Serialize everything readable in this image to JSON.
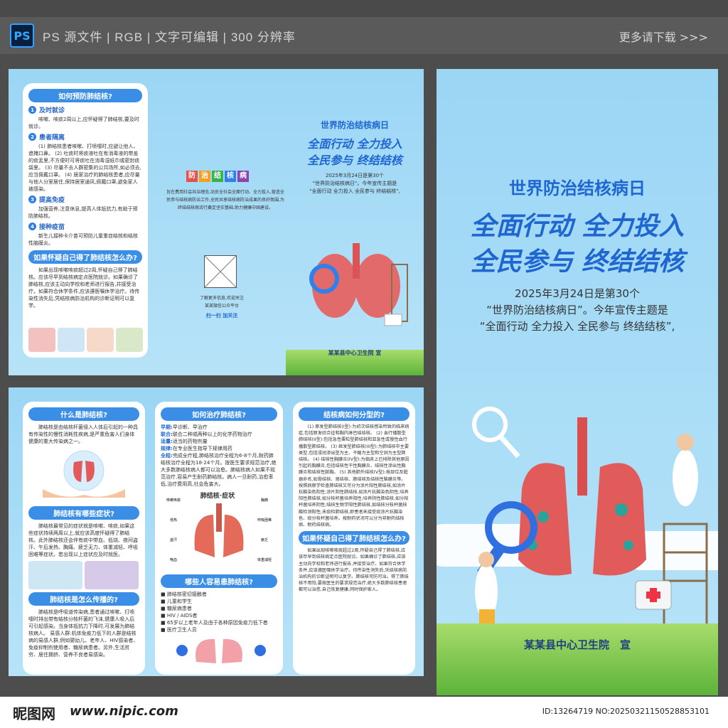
{
  "toolbar": {
    "app_icon": "PS",
    "info": "PS 源文件 | RGB | 文字可编辑 | 300 分辨率",
    "more": "更多请下载 >>>"
  },
  "left_top": {
    "prevent": {
      "title": "如何预防肺结核?",
      "items": [
        {
          "n": "1",
          "h": "及时就诊",
          "t": "咳嗽、咳痰2周以上,应怀疑得了肺结核,要及时就诊。"
        },
        {
          "n": "2",
          "h": "患者隔离",
          "t": "(1) 肺结核患者咳嗽、打喷嚏时,应避让他人、遮掩口鼻。 (2) 吐痰时将痰液吐在有消毒液的带盖的痰盂里,不方便时可将痰吐在消毒湿纸巾或密封痰袋里。 (3) 尽量不去人群密集的公共场所,如必须去,应当佩戴口罩。 (4) 居家治疗的肺结核患者,应尽量与他人分室居住,保持居室通风,佩戴口罩,避免家人被感染。"
        },
        {
          "n": "3",
          "h": "提高免疫",
          "t": "加强营养,注意休息,提高人体抵抗力,有助于预防肺结核。"
        },
        {
          "n": "4",
          "h": "接种疫苗",
          "t": "新生儿接种卡介苗可预防儿童重症结核和结核性脑膜炎。"
        }
      ],
      "suspect_title": "如果怀疑自己得了肺结核怎么办?",
      "suspect_text": "如果出现咳嗽咳痰超过2周,怀疑自己得了肺结核。应该尽早到结核病定点医院就诊。如果确诊了肺结核,应该主动向学校和老师进行报告,并接受治疗。如果符合休学条件,应该遵医嘱休学治疗。待传染性消失后,凭结核病防治机构的诊断证明可以复学。"
    },
    "middle": {
      "badges": [
        "防",
        "治",
        "结",
        "核",
        "病"
      ],
      "intro": "旨在费用社会共治理念,动员全社会全面行动、全力投入,营造全民参与结核病防治工作,全民共享结核病防治成果的良好氛围,为终结结核病流行奠定坚实基础,助力健康中国建设。",
      "qr_text1": "了解更多信息,欢迎关注",
      "qr_text2": "某某微信公众平台",
      "qr_text3": "扫一扫 加关注"
    },
    "cover_small": {
      "t1": "世界防治结核病日",
      "t2": "全面行动 全力投入",
      "t3": "全民参与 终结结核",
      "s1": "2025年3月24日是第30个",
      "s2": "\"世界防治结核病日\"。今年宣传主题是",
      "s3": "\"全面行动 全力投入 全民参与 终结结核\",",
      "org": "某某县中心卫生院 宣"
    }
  },
  "cover": {
    "t1": "世界防治结核病日",
    "t2": "全面行动 全力投入",
    "t3": "全民参与 终结结核",
    "s1": "2025年3月24日是第30个",
    "s2": "“世界防治结核病日”。今年宣传主题是",
    "s3": "“全面行动 全力投入 全民参与 终结结核”,",
    "org": "某某县中心卫生院　宣"
  },
  "bottom": {
    "what": {
      "title": "什么是肺结核?",
      "text": "肺结核是由结核杆菌侵入人体后引起的一种具有传染性的慢性消耗性疾病,是严重危害人们身体健康的重大传染病之一。"
    },
    "symptom": {
      "title": "肺结核有哪些症状?",
      "text": "肺结核最常见的症状就是咳嗽、咳痰,如果这些症状持续两周以上,就应该高度怀疑得了肺结核。此外肺结核还会伴有痰中带血、低烧、夜间盗汗、午后发热、胸痛、疲乏无力、体重减轻、呼吸困难等症状。若出现以上症状应及时就医。"
    },
    "spread": {
      "title": "肺结核是怎么传播的?",
      "text": "肺结核是呼吸道传染病,患者通过咳嗽、打喷嚏时排出带有结核分枝杆菌的飞沫,健康人吸入后可引起感染。当身体抵抗力下降时,可发展为肺结核病人。 易感人群:机体免疫力低下的人群是结核病的易感人群,例如婴幼儿、老年人、HIV感染者、免疫抑制剂使用者、糖尿病患者。另外,生活贫穷、居住拥挤、营养不良者易感染。"
    },
    "treat": {
      "title": "如何治疗肺结核?",
      "rows": [
        {
          "k": "早期:",
          "v": "早诊断、早治疗"
        },
        {
          "k": "联合:",
          "v": "联合二种或两种以上的化学药物治疗"
        },
        {
          "k": "适量:",
          "v": "适当的药物剂量"
        },
        {
          "k": "规律:",
          "v": "在专业医生指导下规律用药"
        },
        {
          "k": "全程:",
          "v": "完成全疗程,肺结核治疗全程为6-8个月,耐药肺结核治疗全程为18-24个月。按医生要求规范治疗,绝大多数肺结核病人都可以治愈。肺结核病人如果不规范治疗,容易产生耐药肺结核。病人一旦耐药,治愈率低,治疗费用高,社会危害大。"
        }
      ],
      "symptom_label": "肺结核·症状",
      "labels": [
        "咳嗽咳痰",
        "低热",
        "盗汗",
        "咯血",
        "胸痛",
        "呼吸困难",
        "疲乏",
        "体重减轻"
      ]
    },
    "who": {
      "title": "哪些人容易患肺结核?",
      "items": [
        "肺结核密切接触者",
        "儿童和学生",
        "糖尿病患者",
        "HIV / AIDS者",
        "65岁以上老年人及由于各种原因免疫力低下者",
        "医疗卫生人员"
      ]
    },
    "types": {
      "title": "结核病如何分型的?",
      "text": "(1) 原发型肺结核(I型):为初次结核感染所致的临床病症,包括原发综合征和胸内淋巴结结核。 (2) 血行播散型肺结核(II型):包括急性粟粒型肺结核和亚急性或慢性血行播散型肺结核。 (3) 继发型肺结核(III型):为肺结核中主要类型,包括浸润渗出型为主、干酪为主型和空洞为主型肺结核。 (4) 结核性胸膜炎(IV型):为临床上已排除其他原因引起的胸膜炎,包括结核性干性胸膜炎、结核性渗出性胸膜炎和结核性脓胸。 (5) 其他肺外结核(V型):按部位及脏器命名,如骨结核、肾结核、肠结核及结核性脑膜炎等。按照病原学检查肺结核又可分为涂片阳性肺结核,如涂片抗酸染色阳性;涂片阴性肺结核,如涂片抗酸染色阴性;培养阳性肺结核,如分枝杆菌培养阳性;培养阴性肺结核,如分枝杆菌培养阴性;结核生物学阳性肺结核,如结核分枝杆菌核酸检测阳性;未痰检肺结核,即患者未接受痰涂片抗酸染色、痰分枝杆菌培养。按耐药状况可以分为非耐药结核病、耐药结核病。"
    },
    "suspect": {
      "title": "如果怀疑自己得了肺结核怎么办?",
      "text": "如果出现咳嗽咳痰超过2周,怀疑自己得了肺结核,应该尽早到结核病定点医院就诊。如果确诊了肺结核,应该主动向学校和老师进行报告,并接受治疗。如果符合休学条件,应该遵医嘱休学治疗。待传染性消失后,凭结核病防治机构的诊断证明可以复学。肺结核可防可治。得了肺结核不用怕,要按医生的要求规范治疗,绝大多数肺结核患者都可以治愈,自己恢复健康,同时保护家人。"
    }
  },
  "watermark": {
    "logo": "昵图网",
    "url": "www.nipic.com",
    "id": "ID:13264719 NO:20250321150528853101"
  },
  "colors": {
    "primary": "#1f66d1",
    "bar": "#3a8ee6",
    "bg": "#4d4d4d"
  }
}
